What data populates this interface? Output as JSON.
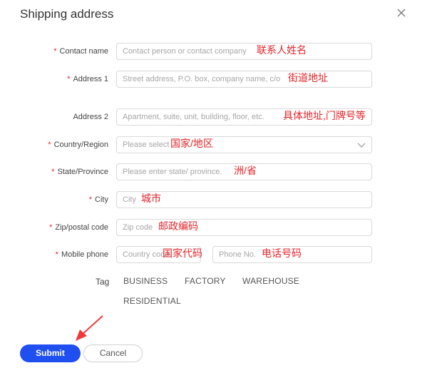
{
  "dialog": {
    "title": "Shipping address",
    "close_icon": "close-icon"
  },
  "form": {
    "contact_name": {
      "label": "Contact name",
      "required": "*",
      "placeholder": "Contact person or contact company",
      "annotation": "联系人姓名"
    },
    "address1": {
      "label": "Address 1",
      "required": "*",
      "placeholder": "Street address, P.O. box, company name, c/o",
      "annotation": "街道地址"
    },
    "address2": {
      "label": "Address 2",
      "placeholder": "Apartment, suite, unit, building, floor, etc.",
      "annotation": "具体地址,门牌号等"
    },
    "country": {
      "label": "Country/Region",
      "required": "*",
      "placeholder": "Please select",
      "annotation": "国家/地区",
      "icon": "chevron-down-icon"
    },
    "state": {
      "label": "State/Province",
      "required": "*",
      "placeholder": "Please enter state/ province.",
      "annotation": "洲/省"
    },
    "city": {
      "label": "City",
      "required": "*",
      "placeholder": "City",
      "annotation": "城市"
    },
    "zip": {
      "label": "Zip/postal code",
      "required": "*",
      "placeholder": "Zip code",
      "annotation": "邮政编码"
    },
    "mobile": {
      "label": "Mobile phone",
      "required": "*",
      "country_code_placeholder": "Country code",
      "country_code_annotation": "国家代码",
      "phone_placeholder": "Phone No.",
      "phone_annotation": "电话号码"
    },
    "tag": {
      "label": "Tag",
      "options": [
        "BUSINESS",
        "FACTORY",
        "WAREHOUSE",
        "RESIDENTIAL"
      ]
    }
  },
  "actions": {
    "submit_label": "Submit",
    "cancel_label": "Cancel"
  },
  "colors": {
    "primary": "#1f4ff0",
    "required": "#e5252a",
    "annotation": "#e5252a"
  }
}
